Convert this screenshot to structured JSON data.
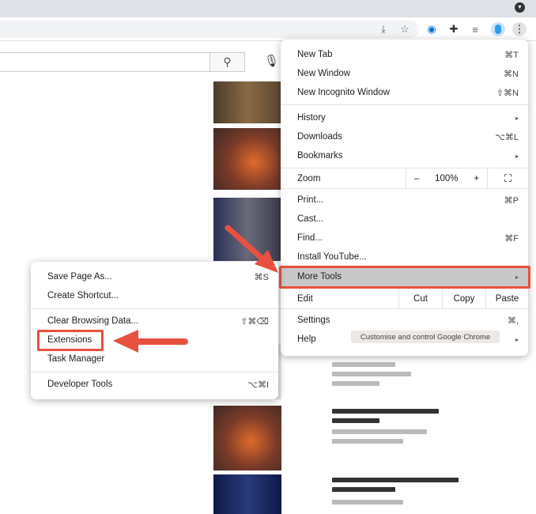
{
  "toolbar": {
    "icons": [
      "install-icon",
      "star-icon",
      "password-icon",
      "extensions-icon",
      "media-icon",
      "profile-icon",
      "menu-icon"
    ]
  },
  "search": {
    "placeholder": ""
  },
  "main_menu": {
    "items": [
      {
        "label": "New Tab",
        "shortcut": "⌘T"
      },
      {
        "label": "New Window",
        "shortcut": "⌘N"
      },
      {
        "label": "New Incognito Window",
        "shortcut": "⇧⌘N"
      },
      {
        "label": "History",
        "shortcut": "▸"
      },
      {
        "label": "Downloads",
        "shortcut": "⌥⌘L"
      },
      {
        "label": "Bookmarks",
        "shortcut": "▸"
      },
      {
        "label": "Print...",
        "shortcut": "⌘P"
      },
      {
        "label": "Cast...",
        "shortcut": ""
      },
      {
        "label": "Find...",
        "shortcut": "⌘F"
      },
      {
        "label": "Install YouTube...",
        "shortcut": ""
      },
      {
        "label": "More Tools",
        "shortcut": "▸"
      },
      {
        "label": "Settings",
        "shortcut": "⌘,"
      },
      {
        "label": "Help",
        "shortcut": "▸"
      }
    ],
    "zoom": {
      "label": "Zoom",
      "minus": "–",
      "value": "100%",
      "plus": "+",
      "fullscreen": "⛶"
    },
    "edit": {
      "label": "Edit",
      "cut": "Cut",
      "copy": "Copy",
      "paste": "Paste"
    }
  },
  "tooltip": "Customise and control Google Chrome",
  "sub_menu": {
    "items": [
      {
        "label": "Save Page As...",
        "shortcut": "⌘S"
      },
      {
        "label": "Create Shortcut...",
        "shortcut": ""
      },
      {
        "label": "Clear Browsing Data...",
        "shortcut": "⇧⌘⌫"
      },
      {
        "label": "Extensions",
        "shortcut": ""
      },
      {
        "label": "Task Manager",
        "shortcut": ""
      },
      {
        "label": "Developer Tools",
        "shortcut": "⌥⌘I"
      }
    ]
  },
  "colors": {
    "highlight": "#e8503f",
    "menu_hover": "#c8c8c8"
  }
}
